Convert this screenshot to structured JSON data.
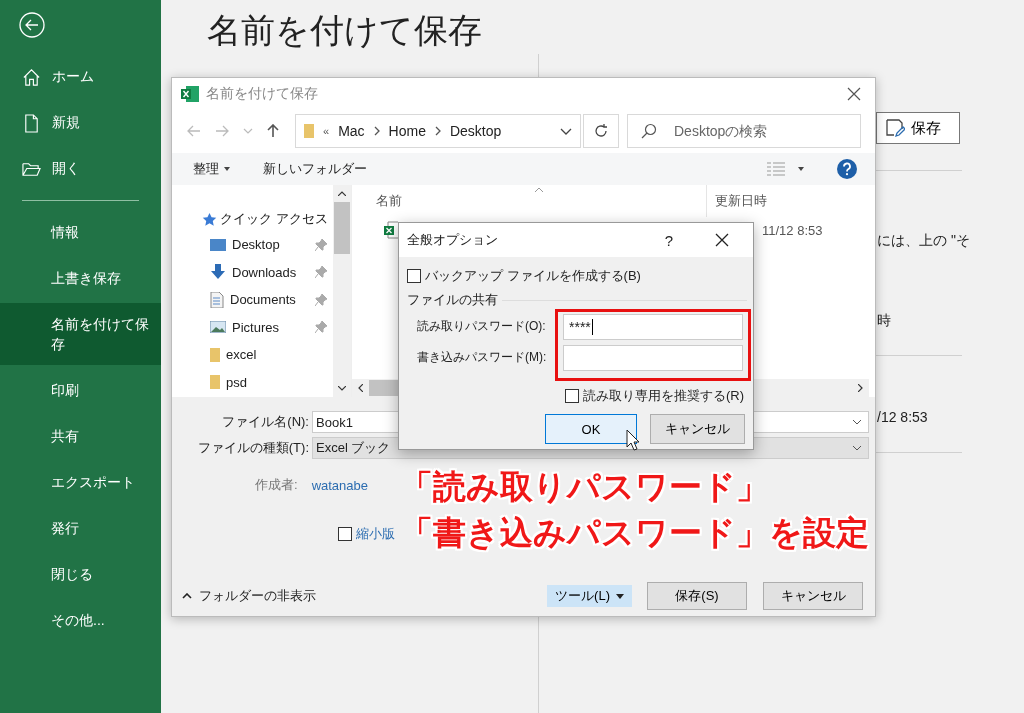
{
  "sidebar": {
    "top_items": [
      {
        "label": "ホーム",
        "kind": "home"
      },
      {
        "label": "新規",
        "kind": "new"
      },
      {
        "label": "開く",
        "kind": "open"
      }
    ],
    "items": [
      {
        "label": "情報",
        "selected": false
      },
      {
        "label": "上書き保存",
        "selected": false
      },
      {
        "label": "名前を付けて保存",
        "selected": true
      },
      {
        "label": "印刷",
        "selected": false
      },
      {
        "label": "共有",
        "selected": false
      },
      {
        "label": "エクスポート",
        "selected": false
      },
      {
        "label": "発行",
        "selected": false
      },
      {
        "label": "閉じる",
        "selected": false
      },
      {
        "label": "その他...",
        "selected": false
      }
    ]
  },
  "page": {
    "title": "名前を付けて保存",
    "save_button": "保存",
    "texts": [
      "には、上の \"そ",
      "時",
      "/12 8:53"
    ]
  },
  "save_dialog": {
    "title": "名前を付けて保存",
    "address": {
      "overflow": "«",
      "path": [
        "Mac",
        "Home",
        "Desktop"
      ]
    },
    "search": {
      "placeholder": "Desktopの検索"
    },
    "toolbar": {
      "organize": "整理",
      "new_folder": "新しいフォルダー"
    },
    "nav": {
      "header": "クイック アクセス",
      "items": [
        {
          "label": "Desktop",
          "kind": "desktop",
          "pinned": true
        },
        {
          "label": "Downloads",
          "kind": "download",
          "pinned": true
        },
        {
          "label": "Documents",
          "kind": "document",
          "pinned": true
        },
        {
          "label": "Pictures",
          "kind": "pictures",
          "pinned": true
        },
        {
          "label": "excel",
          "kind": "folder",
          "pinned": false
        },
        {
          "label": "psd",
          "kind": "folder",
          "pinned": false
        }
      ]
    },
    "columns": [
      "名前",
      "更新日時"
    ],
    "files": [
      {
        "modified": "11/12 8:53"
      }
    ],
    "file_name_label": "ファイル名(N):",
    "file_name": "Book1",
    "file_type_label": "ファイルの種類(T):",
    "file_type": "Excel ブック",
    "author_label": "作成者:",
    "author": "watanabe",
    "thumbnail": {
      "label": "縮小版",
      "checked": false
    },
    "hide_folders": "フォルダーの非表示",
    "tools": "ツール(L)",
    "save": "保存(S)",
    "cancel": "キャンセル"
  },
  "options_dialog": {
    "title": "全般オプション",
    "help": "?",
    "backup": {
      "label": "バックアップ ファイルを作成する(B)",
      "checked": false
    },
    "group": "ファイルの共有",
    "read_password": {
      "label": "読み取りパスワード(O):",
      "value": "****"
    },
    "write_password": {
      "label": "書き込みパスワード(M):"
    },
    "readonly": {
      "label": "読み取り専用を推奨する(R)",
      "checked": false
    },
    "ok": "OK",
    "cancel": "キャンセル"
  },
  "annotation": {
    "lines": [
      "「読み取りパスワード」",
      "「書き込みパスワード」を設定"
    ]
  }
}
